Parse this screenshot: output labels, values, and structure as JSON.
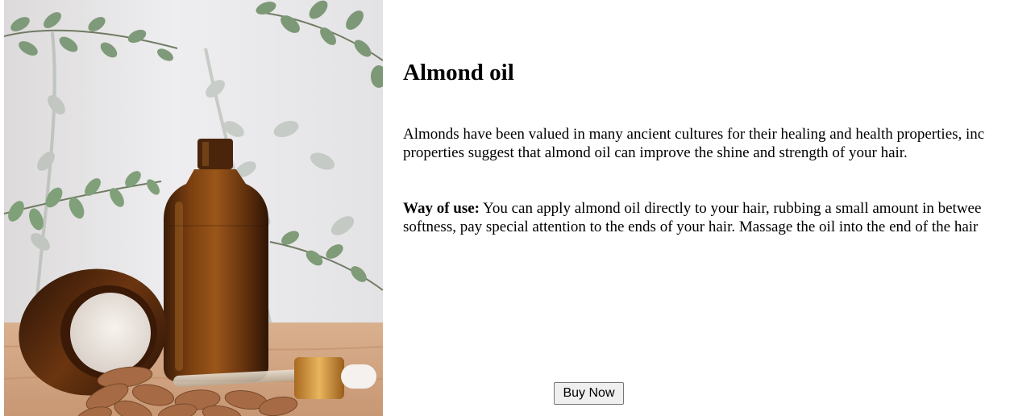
{
  "product": {
    "title": "Almond oil",
    "image_alt": "Amber almond oil bottle with dropper, open cream jar and almonds",
    "description_lines": [
      "Almonds have been valued in many ancient cultures for their healing and health properties, inc",
      "properties suggest that almond oil can improve the shine and strength of your hair."
    ],
    "usage_label": "Way of use:",
    "usage_lines": [
      " You can apply almond oil directly to your hair, rubbing a small amount in betwee",
      "softness, pay special attention to the ends of your hair. Massage the oil into the end of the hair"
    ],
    "buy_label": "Buy Now"
  }
}
